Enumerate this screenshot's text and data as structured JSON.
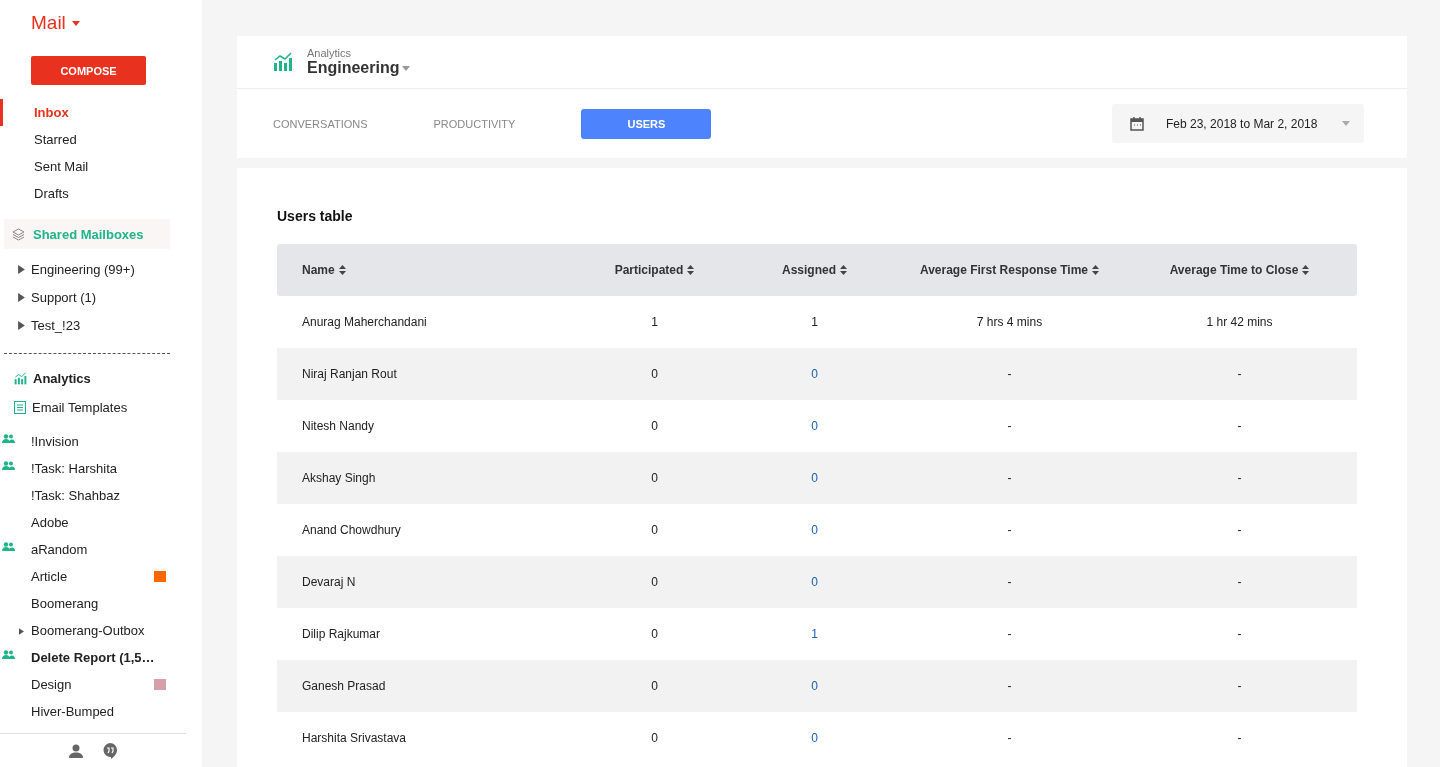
{
  "sidebar": {
    "app_menu": "Mail",
    "compose": "COMPOSE",
    "folders": [
      {
        "label": "Inbox",
        "selected": true
      },
      {
        "label": "Starred",
        "selected": false
      },
      {
        "label": "Sent Mail",
        "selected": false
      },
      {
        "label": "Drafts",
        "selected": false
      }
    ],
    "shared_header": "Shared Mailboxes",
    "shared": [
      {
        "label": "Engineering (99+)"
      },
      {
        "label": "Support (1)"
      },
      {
        "label": "Test_!23"
      }
    ],
    "tools": [
      {
        "label": "Analytics",
        "kind": "analytics",
        "selected": true
      },
      {
        "label": "Email Templates",
        "kind": "templates",
        "selected": false
      }
    ],
    "labels": [
      {
        "label": "!Invision",
        "shared": true,
        "bold": false,
        "expandable": false
      },
      {
        "label": "!Task: Harshita",
        "shared": true,
        "bold": false,
        "expandable": false
      },
      {
        "label": "!Task: Shahbaz",
        "shared": false,
        "bold": false,
        "expandable": false
      },
      {
        "label": "Adobe",
        "shared": false,
        "bold": false,
        "expandable": false
      },
      {
        "label": "aRandom",
        "shared": true,
        "bold": false,
        "expandable": false
      },
      {
        "label": "Article",
        "shared": false,
        "bold": false,
        "expandable": false,
        "color": "#ff6600"
      },
      {
        "label": "Boomerang",
        "shared": false,
        "bold": false,
        "expandable": false
      },
      {
        "label": "Boomerang-Outbox",
        "shared": false,
        "bold": false,
        "expandable": true
      },
      {
        "label": "Delete Report (1,5…",
        "shared": true,
        "bold": true,
        "expandable": false
      },
      {
        "label": "Design",
        "shared": false,
        "bold": false,
        "expandable": false,
        "color": "#d5a0a8"
      },
      {
        "label": "Hiver-Bumped",
        "shared": false,
        "bold": false,
        "expandable": false
      }
    ]
  },
  "header": {
    "caption": "Analytics",
    "mailbox": "Engineering",
    "tabs": [
      {
        "label": "CONVERSATIONS",
        "selected": false
      },
      {
        "label": "PRODUCTIVITY",
        "selected": false
      },
      {
        "label": "USERS",
        "selected": true
      }
    ],
    "date_range": "Feb 23, 2018 to Mar 2, 2018"
  },
  "table": {
    "title": "Users table",
    "columns": [
      "Name",
      "Participated",
      "Assigned",
      "Average First Response Time",
      "Average Time to Close"
    ],
    "rows": [
      {
        "cells": [
          "Anurag Maherchandani",
          "1",
          "1",
          "7 hrs 4 mins",
          "1 hr 42 mins"
        ],
        "linked": false
      },
      {
        "cells": [
          "Niraj Ranjan Rout",
          "0",
          "0",
          "-",
          "-"
        ],
        "linked": true
      },
      {
        "cells": [
          "Nitesh Nandy",
          "0",
          "0",
          "-",
          "-"
        ],
        "linked": true
      },
      {
        "cells": [
          "Akshay Singh",
          "0",
          "0",
          "-",
          "-"
        ],
        "linked": true
      },
      {
        "cells": [
          "Anand Chowdhury",
          "0",
          "0",
          "-",
          "-"
        ],
        "linked": true
      },
      {
        "cells": [
          "Devaraj N",
          "0",
          "0",
          "-",
          "-"
        ],
        "linked": true
      },
      {
        "cells": [
          "Dilip Rajkumar",
          "0",
          "1",
          "-",
          "-"
        ],
        "linked": true
      },
      {
        "cells": [
          "Ganesh Prasad",
          "0",
          "0",
          "-",
          "-"
        ],
        "linked": true
      },
      {
        "cells": [
          "Harshita Srivastava",
          "0",
          "0",
          "-",
          "-"
        ],
        "linked": true
      }
    ]
  }
}
